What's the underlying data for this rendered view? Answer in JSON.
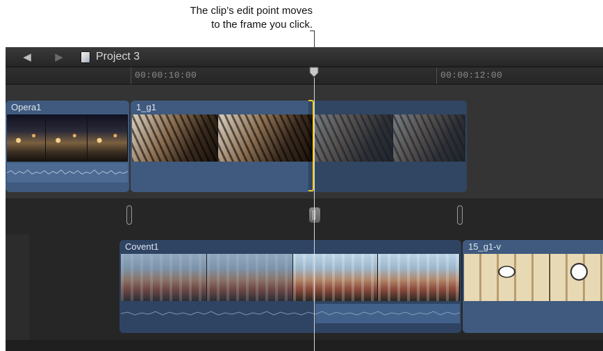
{
  "callout": {
    "line1": "The clip’s edit point moves",
    "line2": "to the frame you click."
  },
  "toolbar": {
    "back_icon": "left-arrow-icon",
    "forward_icon": "right-arrow-icon",
    "project_icon": "project-document-icon",
    "project_title": "Project 3"
  },
  "timeline": {
    "timecodes": [
      "00:00:10:00",
      "00:00:12:00"
    ],
    "clips": {
      "opera": "Opera1",
      "g1": "1_g1",
      "covent": "Covent1",
      "g1v": "15_g1-v"
    }
  },
  "colors": {
    "clip_blue": "#3f5a7e",
    "trim_yellow": "#f2cd25",
    "background": "#2b2b2b"
  }
}
